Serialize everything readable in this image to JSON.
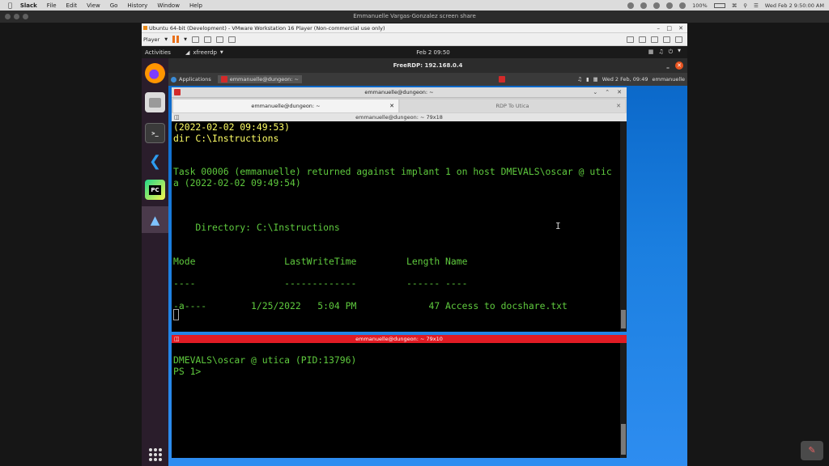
{
  "mac_menu": {
    "app": "Slack",
    "items": [
      "File",
      "Edit",
      "View",
      "Go",
      "History",
      "Window",
      "Help"
    ],
    "battery": "100%",
    "clock": "Wed Feb 2  9:50:00 AM"
  },
  "share_bar": {
    "title": "Emmanuelle Vargas-Gonzalez screen share"
  },
  "vmware": {
    "title": "Ubuntu 64-bit (Development) - VMware Workstation 16 Player (Non-commercial use only)",
    "player_label": "Player"
  },
  "ubuntu": {
    "activities": "Activities",
    "app_name": "xfreerdp",
    "clock": "Feb 2  09:50"
  },
  "dock": {
    "pycharm_label": "PC"
  },
  "rdp": {
    "title": "FreeRDP: 192.168.0.4"
  },
  "xfce": {
    "applications": "Applications",
    "task_label": "emmanuelle@dungeon: ~",
    "clock": "Wed  2 Feb, 09:49",
    "user": "emmanuelle"
  },
  "terminal": {
    "window_title": "emmanuelle@dungeon: ~",
    "tabs": [
      {
        "label": "emmanuelle@dungeon: ~"
      },
      {
        "label": "RDP To Utica"
      }
    ],
    "pane1_header": "emmanuelle@dungeon: ~ 79x18",
    "pane1_lines": [
      "(2022-02-02 09:49:53)",
      "dir C:\\Instructions",
      "Task 00006 (emmanuelle) returned against implant 1 on host DMEVALS\\oscar @ utic",
      "a (2022-02-02 09:49:54)",
      "    Directory: C:\\Instructions",
      "Mode                LastWriteTime         Length Name",
      "----                -------------         ------ ----",
      "-a----        1/25/2022   5:04 PM             47 Access to docshare.txt"
    ],
    "pane2_header": "emmanuelle@dungeon: ~ 79x10",
    "pane2_lines": [
      "DMEVALS\\oscar @ utica (PID:13796)",
      "PS 1>"
    ]
  }
}
